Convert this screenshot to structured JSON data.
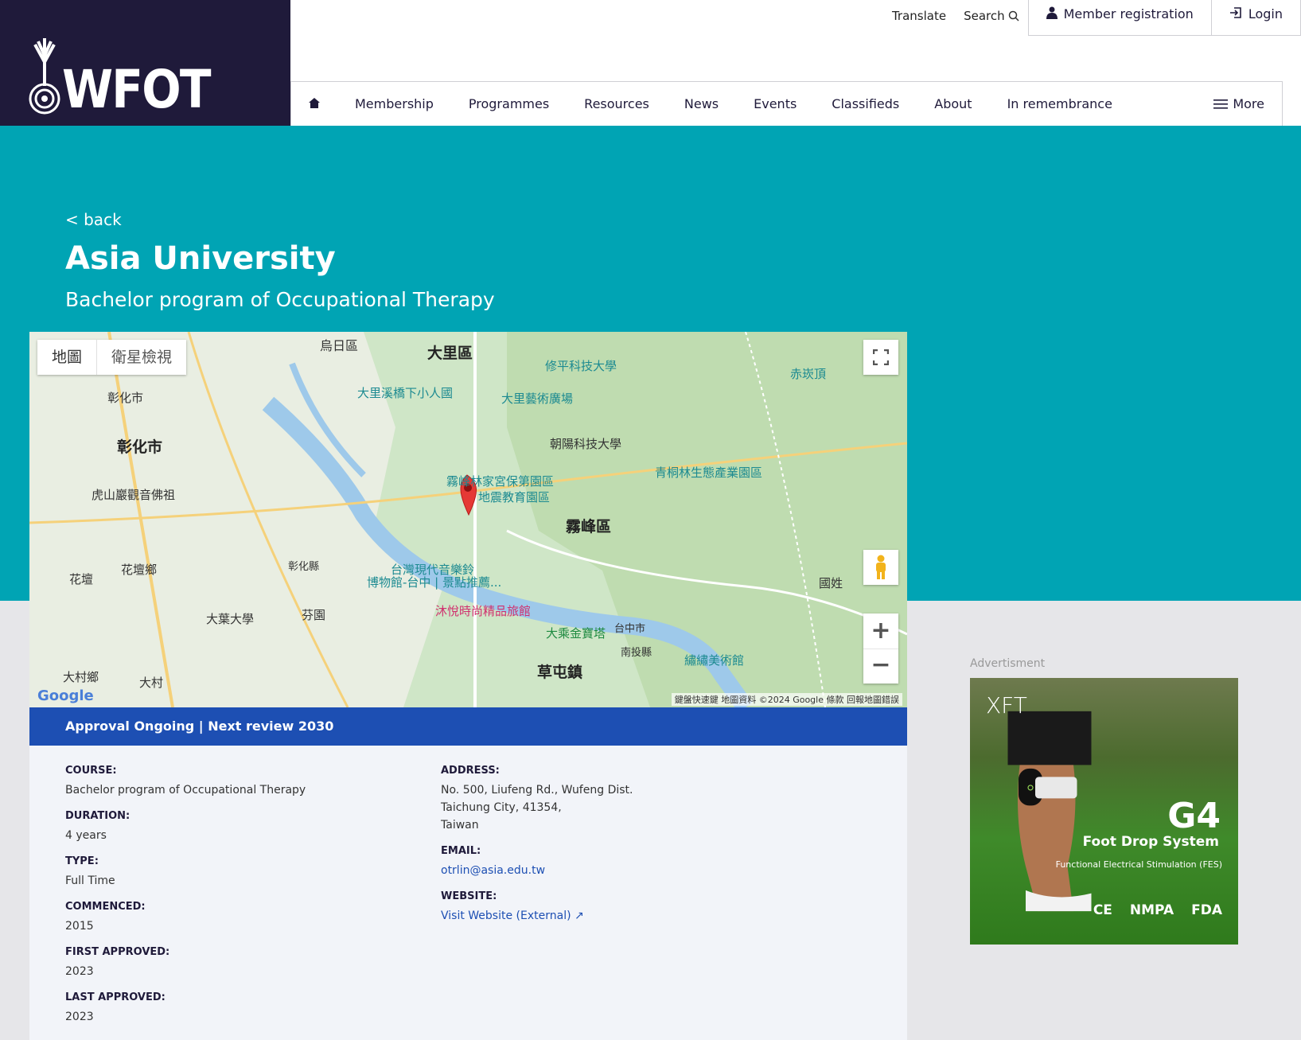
{
  "header": {
    "logo_text": "WFOT",
    "util": {
      "translate": "Translate",
      "search": "Search",
      "member_registration": "Member registration",
      "login": "Login"
    },
    "nav": [
      "Membership",
      "Programmes",
      "Resources",
      "News",
      "Events",
      "Classifieds",
      "About",
      "In remembrance"
    ],
    "more": "More"
  },
  "page": {
    "back": "< back",
    "title": "Asia University",
    "subtitle": "Bachelor program of Occupational Therapy"
  },
  "map": {
    "type_map": "地圖",
    "type_satellite": "衛星檢視",
    "labels": {
      "dali": "大里區",
      "wuri": "烏日區",
      "changhua_city": "彰化市",
      "changhua_city2": "彰化市",
      "wufeng": "霧峰區",
      "caotun": "草屯鎮",
      "huatan": "花壇鄉",
      "huatan2": "花壇",
      "fenyuan": "芬園",
      "dacun_town": "大村鄉",
      "dacun": "大村",
      "guoxing": "國姓",
      "xiuping": "修平科技大學",
      "dali_art": "大里藝術廣場",
      "dali_bridge": "大里溪橋下小人國",
      "chaoyang": "朝陽科技大學",
      "wufeng_lin": "霧峰林家宮保第園區",
      "earthquake": "地震教育園區",
      "qingtong": "青桐林生態產業園區",
      "chikanding": "赤崁頂",
      "huishan": "虎山巖觀音佛祖",
      "museum": "台灣現代音樂鈴",
      "museum2": "博物館-台中 | 景點推薦...",
      "hotel": "沐悅時尚精品旅館",
      "dacheng": "大乘金寶塔",
      "dayeh": "大葉大學",
      "embroidery": "繡繡美術館",
      "taichung": "台中市",
      "nantou": "南投縣",
      "changhua_county": "彰化縣"
    },
    "footer": "鍵盤快速鍵   地圖資料 ©2024 Google   條款   回報地圖錯誤",
    "google": "Google"
  },
  "status": "Approval Ongoing | Next review 2030",
  "details": {
    "course_label": "COURSE:",
    "course": "Bachelor program of Occupational Therapy",
    "duration_label": "DURATION:",
    "duration": "4 years",
    "type_label": "TYPE:",
    "type": "Full Time",
    "commenced_label": "COMMENCED:",
    "commenced": "2015",
    "first_label": "FIRST APPROVED:",
    "first": "2023",
    "last_label": "LAST APPROVED:",
    "last": "2023",
    "address_label": "ADDRESS:",
    "address1": "No. 500, Liufeng Rd., Wufeng Dist.",
    "address2": "Taichung City, 41354,",
    "address3": "Taiwan",
    "email_label": "EMAIL:",
    "email": "otrlin@asia.edu.tw",
    "website_label": "WEBSITE:",
    "website": "Visit Website (External) ↗"
  },
  "ad": {
    "label": "Advertisment",
    "brand": "XFT",
    "title": "G4",
    "subtitle": "Foot Drop System",
    "fes": "Functional Electrical Stimulation (FES)",
    "marks": [
      "CE",
      "NMPA",
      "FDA"
    ]
  },
  "colors": {
    "navy": "#1f1a3a",
    "teal": "#00a4b4",
    "blue": "#1d4fb3"
  }
}
